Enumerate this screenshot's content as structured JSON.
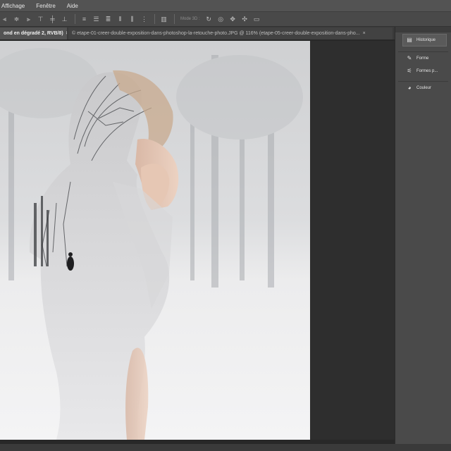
{
  "menu": {
    "items": [
      "Affichage",
      "Fenêtre",
      "Aide"
    ]
  },
  "options_bar": {
    "icons": [
      "align-left-icon",
      "align-center-icon",
      "align-right-icon",
      "align-top-icon",
      "align-middle-icon",
      "align-bottom-icon",
      "distribute-top-icon",
      "distribute-middle-icon",
      "distribute-bottom-icon",
      "distribute-left-icon",
      "distribute-center-icon",
      "distribute-right-icon",
      "auto-align-icon",
      "orbit-3d-icon",
      "roll-3d-icon",
      "drag-3d-icon",
      "slide-3d-icon",
      "scale-3d-icon"
    ],
    "mode_3d_label": "Mode 3D :"
  },
  "tabs": [
    {
      "label": "ond en dégradé 2, RVB/8)",
      "close": "×"
    },
    {
      "label": "© etape-01-creer-double-exposition-dans-photoshop-la-retouche-photo.JPG @ 116% (etape-05-creer-double-exposition-dans-pho...",
      "close": "×"
    }
  ],
  "panels": [
    {
      "label": "Historique",
      "icon": "history-icon",
      "selected": true
    },
    {
      "label": "Forme",
      "icon": "brush-icon",
      "selected": false
    },
    {
      "label": "Formes p...",
      "icon": "brush-presets-icon",
      "selected": false
    },
    {
      "label": "Couleur",
      "icon": "color-icon",
      "selected": false
    }
  ],
  "colors": {
    "menubar": "#535353",
    "options": "#494949",
    "panel": "#4a4a4a",
    "workspace": "#282828",
    "snow": "#e9e9ea"
  }
}
